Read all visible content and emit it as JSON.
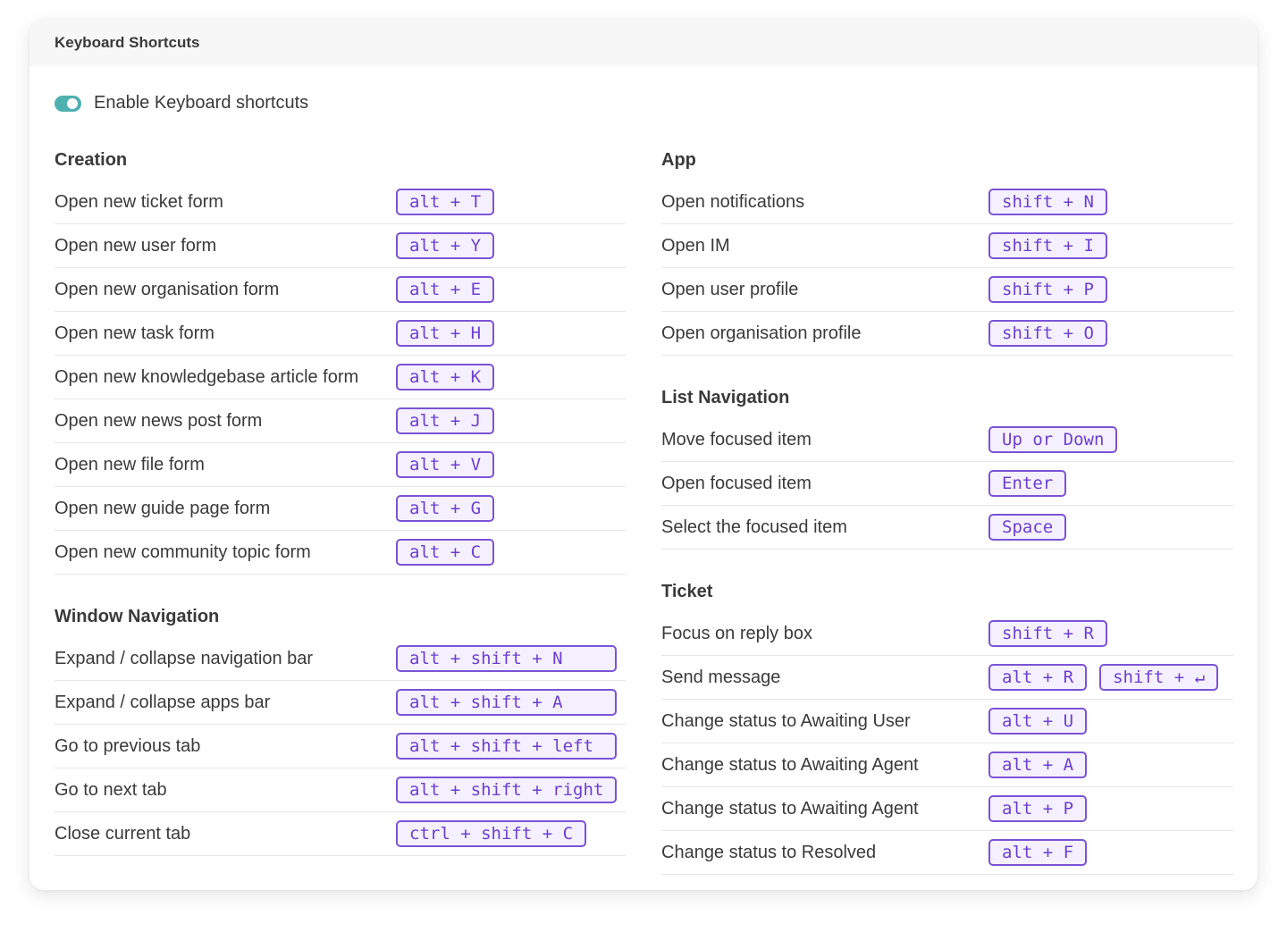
{
  "header": {
    "title": "Keyboard Shortcuts"
  },
  "toggle": {
    "label": "Enable Keyboard shortcuts",
    "enabled": true,
    "color": "#4fb0b0"
  },
  "accent": {
    "key_border": "#7b53d6",
    "key_text": "#6a3fd0",
    "key_bg": "#f5f0ff"
  },
  "left_column": [
    {
      "title": "Creation",
      "rows": [
        {
          "label": "Open new ticket form",
          "keys": [
            "alt + T"
          ]
        },
        {
          "label": "Open new user form",
          "keys": [
            "alt + Y"
          ]
        },
        {
          "label": "Open new organisation form",
          "keys": [
            "alt + E"
          ]
        },
        {
          "label": "Open new task form",
          "keys": [
            "alt + H"
          ]
        },
        {
          "label": "Open new knowledgebase article form",
          "keys": [
            "alt + K"
          ]
        },
        {
          "label": "Open new news post form",
          "keys": [
            "alt + J"
          ]
        },
        {
          "label": "Open new file form",
          "keys": [
            "alt + V"
          ]
        },
        {
          "label": "Open new guide page form",
          "keys": [
            "alt + G"
          ]
        },
        {
          "label": "Open new community topic form",
          "keys": [
            "alt + C"
          ]
        }
      ]
    },
    {
      "title": "Window Navigation",
      "rows": [
        {
          "label": "Expand / collapse navigation bar",
          "keys": [
            "alt + shift + N    "
          ]
        },
        {
          "label": "Expand / collapse apps bar",
          "keys": [
            "alt + shift + A    "
          ]
        },
        {
          "label": "Go to previous tab",
          "keys": [
            "alt + shift + left "
          ]
        },
        {
          "label": "Go to next tab",
          "keys": [
            "alt + shift + right"
          ]
        },
        {
          "label": "Close current tab",
          "keys": [
            "ctrl + shift + C"
          ]
        }
      ]
    }
  ],
  "right_column": [
    {
      "title": "App",
      "rows": [
        {
          "label": "Open notifications",
          "keys": [
            "shift + N"
          ]
        },
        {
          "label": "Open IM",
          "keys": [
            "shift + I"
          ]
        },
        {
          "label": "Open user profile",
          "keys": [
            "shift + P"
          ]
        },
        {
          "label": "Open organisation profile",
          "keys": [
            "shift + O"
          ]
        }
      ]
    },
    {
      "title": "List Navigation",
      "rows": [
        {
          "label": "Move focused item",
          "keys": [
            "Up or Down"
          ]
        },
        {
          "label": "Open focused item",
          "keys": [
            "Enter"
          ]
        },
        {
          "label": "Select the focused item",
          "keys": [
            "Space"
          ]
        }
      ]
    },
    {
      "title": "Ticket",
      "rows": [
        {
          "label": "Focus on reply box",
          "keys": [
            "shift + R"
          ]
        },
        {
          "label": "Send message",
          "keys": [
            "alt + R",
            "shift + ↵"
          ]
        },
        {
          "label": "Change status to Awaiting User",
          "keys": [
            "alt + U"
          ]
        },
        {
          "label": "Change status to Awaiting Agent",
          "keys": [
            "alt + A"
          ]
        },
        {
          "label": "Change status to Awaiting Agent",
          "keys": [
            "alt + P"
          ]
        },
        {
          "label": "Change status to Resolved",
          "keys": [
            "alt + F"
          ]
        }
      ]
    }
  ]
}
